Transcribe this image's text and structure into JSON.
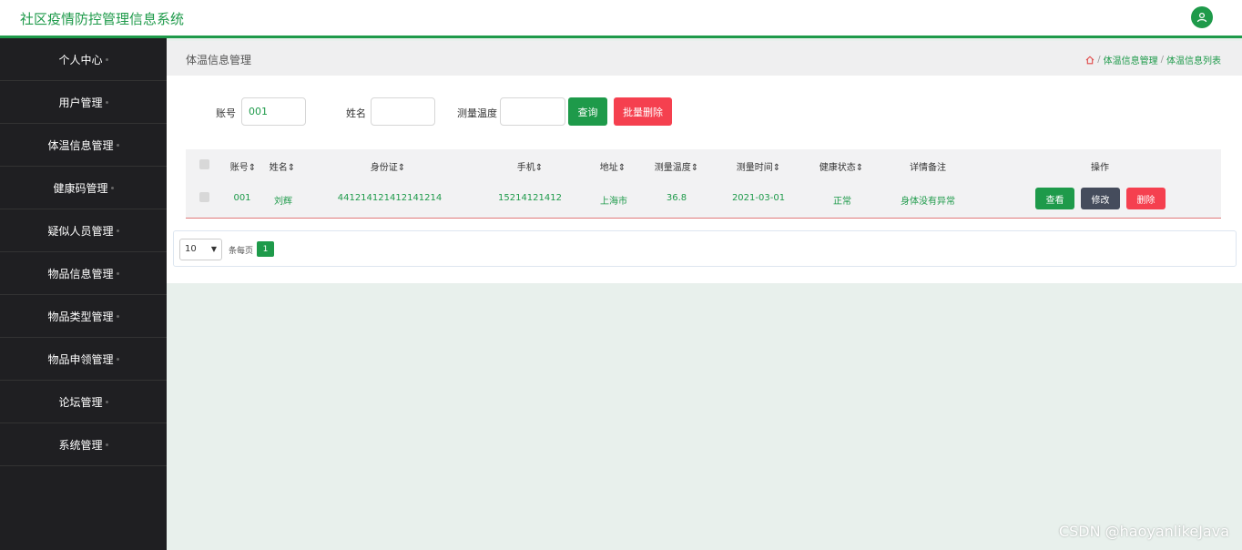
{
  "header": {
    "app_title": "社区疫情防控管理信息系统",
    "user_icon": "user-icon"
  },
  "sidebar": {
    "items": [
      {
        "label": "个人中心"
      },
      {
        "label": "用户管理"
      },
      {
        "label": "体温信息管理"
      },
      {
        "label": "健康码管理"
      },
      {
        "label": "疑似人员管理"
      },
      {
        "label": "物品信息管理"
      },
      {
        "label": "物品类型管理"
      },
      {
        "label": "物品申领管理"
      },
      {
        "label": "论坛管理"
      },
      {
        "label": "系统管理"
      }
    ]
  },
  "breadcrumb": {
    "title": "体温信息管理",
    "home_icon": "home-icon",
    "path": [
      "体温信息管理",
      "体温信息列表"
    ],
    "separator": "/"
  },
  "search": {
    "account_label": "账号",
    "account_value": "001",
    "name_label": "姓名",
    "name_value": "",
    "temp_label": "测量温度",
    "temp_value": "",
    "query_button": "查询",
    "batch_delete_button": "批量删除"
  },
  "table": {
    "columns": [
      "账号",
      "姓名",
      "身份证",
      "手机",
      "地址",
      "测量温度",
      "测量时间",
      "健康状态",
      "详情备注",
      "操作"
    ],
    "sort_glyph": "⇕",
    "rows": [
      {
        "account": "001",
        "name": "刘辉",
        "id_card": "441214121412141214",
        "phone": "15214121412",
        "address": "上海市",
        "temperature": "36.8",
        "time": "2021-03-01",
        "health": "正常",
        "remark": "身体没有异常",
        "actions": {
          "view": "查看",
          "edit": "修改",
          "delete": "删除"
        }
      }
    ]
  },
  "pagination": {
    "per_page": "10",
    "per_page_label": "条每页",
    "current_page": "1"
  },
  "watermark": "CSDN @haoyanlikeJava",
  "colors": {
    "primary": "#1e9a4a",
    "danger": "#f5404f",
    "dark_button": "#454c5c",
    "sidebar_bg": "#1f1f22"
  }
}
